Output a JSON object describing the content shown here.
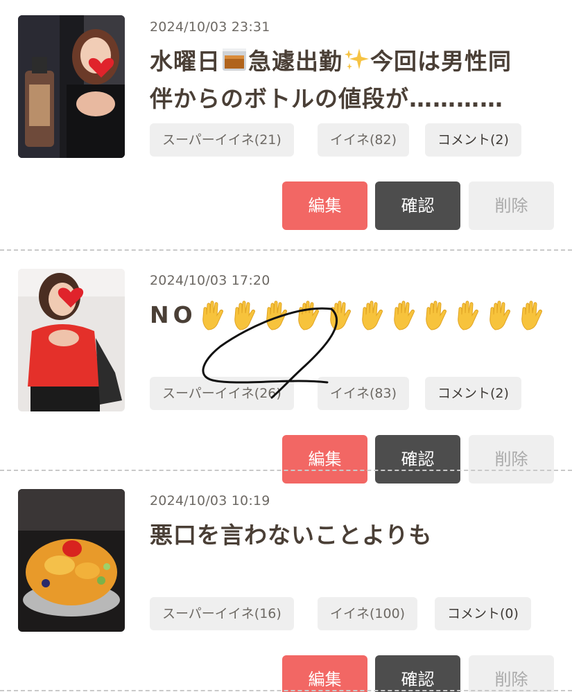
{
  "posts": [
    {
      "date": "2024/10/03 23:31",
      "title_part1": "水曜日",
      "title_part2": "急遽出勤",
      "title_part3": "今回は男性同\n伴からのボトルの値段が…………",
      "chips": {
        "super_like": "スーパーイイネ(21)",
        "like": "イイネ(82)",
        "comment": "コメント(2)"
      },
      "buttons": {
        "edit": "編集",
        "confirm": "確認",
        "delete": "削除"
      }
    },
    {
      "date": "2024/10/03 17:20",
      "title": "NO",
      "hand_count": 11,
      "chips": {
        "super_like": "スーパーイイネ(26)",
        "like": "イイネ(83)",
        "comment": "コメント(2)"
      },
      "buttons": {
        "edit": "編集",
        "confirm": "確認",
        "delete": "削除"
      }
    },
    {
      "date": "2024/10/03 10:19",
      "title": "悪口を言わないことよりも",
      "chips": {
        "super_like": "スーパーイイネ(16)",
        "like": "イイネ(100)",
        "comment": "コメント(0)"
      },
      "buttons": {
        "edit": "編集",
        "confirm": "確認",
        "delete": "削除"
      }
    }
  ],
  "colors": {
    "edit": "#f26764",
    "confirm": "#4d4d4d",
    "delete": "#efefef",
    "chip": "#efefef",
    "title": "#4a3f36"
  },
  "icons": {
    "whisky": "whisky-glass-icon",
    "sparkles": "sparkles-icon",
    "hand": "raised-hand-icon",
    "heart": "heart-icon"
  }
}
